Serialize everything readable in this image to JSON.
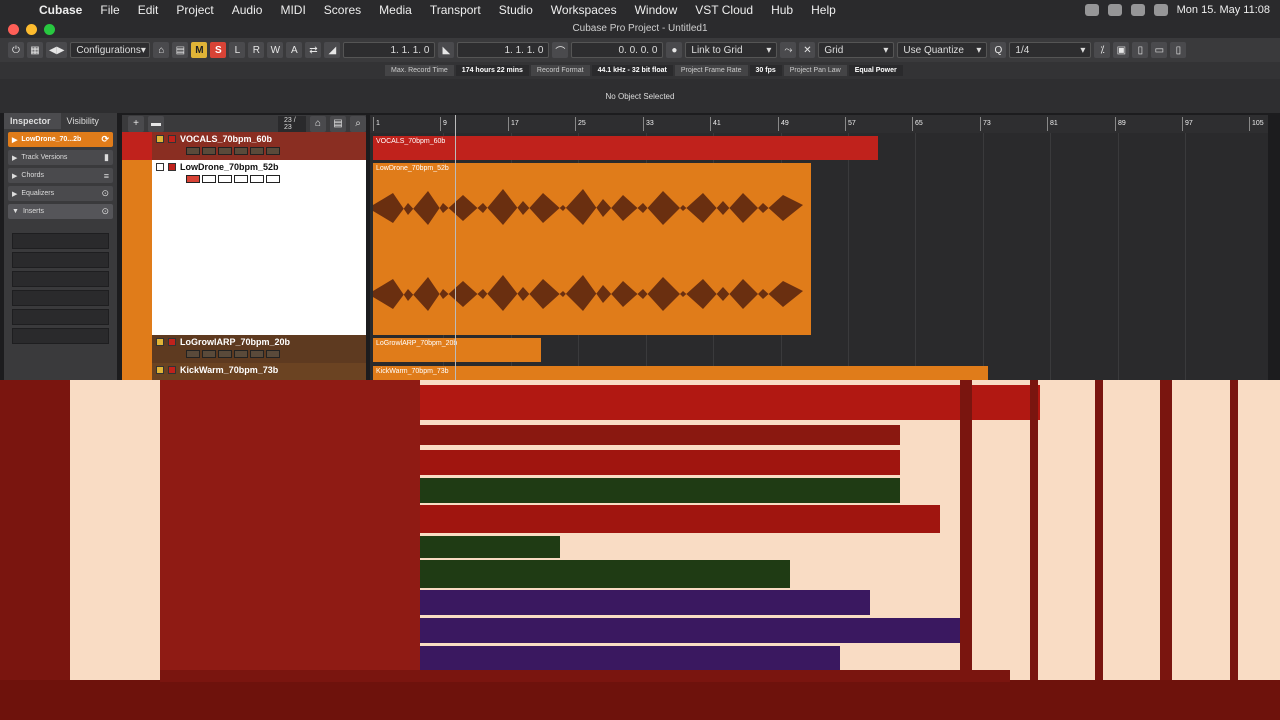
{
  "menubar": {
    "app": "Cubase",
    "items": [
      "File",
      "Edit",
      "Project",
      "Audio",
      "MIDI",
      "Scores",
      "Media",
      "Transport",
      "Studio",
      "Workspaces",
      "Window",
      "VST Cloud",
      "Hub",
      "Help"
    ],
    "clock": "Mon 15. May 11:08"
  },
  "window": {
    "title": "Cubase Pro Project - Untitled1"
  },
  "toolbar": {
    "configurations": "Configurations",
    "m": "M",
    "s": "S",
    "l": "L",
    "r": "R",
    "w": "W",
    "a": "A",
    "left_locator": "1. 1. 1. 0",
    "right_locator": "1. 1. 1. 0",
    "length": "0. 0. 0. 0",
    "link": "Link to Grid",
    "grid": "Grid",
    "quantize_mode": "Use Quantize",
    "quantize_value": "1/4"
  },
  "infobar": {
    "max_record_label": "Max. Record Time",
    "max_record_value": "174 hours 22 mins",
    "record_format_label": "Record Format",
    "record_format_value": "44.1 kHz - 32 bit float",
    "frame_rate_label": "Project Frame Rate",
    "frame_rate_value": "30 fps",
    "pan_law_label": "Project Pan Law",
    "pan_law_value": "Equal Power"
  },
  "status": {
    "selection": "No Object Selected"
  },
  "inspector": {
    "tab_inspector": "Inspector",
    "tab_visibility": "Visibility",
    "track_name": "LowDrone_70...2b",
    "sections": [
      "Track Versions",
      "Chords",
      "Equalizers",
      "Inserts"
    ]
  },
  "tracklist": {
    "count": "23 / 23",
    "tracks": [
      {
        "name": "VOCALS_70bpm_60b",
        "color": "#c0221c"
      },
      {
        "name": "LowDrone_70bpm_52b",
        "color": "#e07c1a"
      },
      {
        "name": "LoGrowlARP_70bpm_20b",
        "color": "#6b3c1a"
      },
      {
        "name": "KickWarm_70bpm_73b",
        "color": "#e07c1a"
      }
    ]
  },
  "ruler": {
    "bars": [
      "1",
      "9",
      "17",
      "25",
      "33",
      "41",
      "49",
      "57",
      "65",
      "73",
      "81",
      "89",
      "97",
      "105"
    ]
  },
  "events": [
    {
      "label": "VOCALS_70bpm_60b",
      "color": "#c0221c"
    },
    {
      "label": "LowDrone_70bpm_52b",
      "color": "#e07c1a"
    },
    {
      "label": "LoGrowlARP_70bpm_20b",
      "color": "#e07c1a"
    },
    {
      "label": "KickWarm_70bpm_73b",
      "color": "#e07c1a"
    }
  ]
}
